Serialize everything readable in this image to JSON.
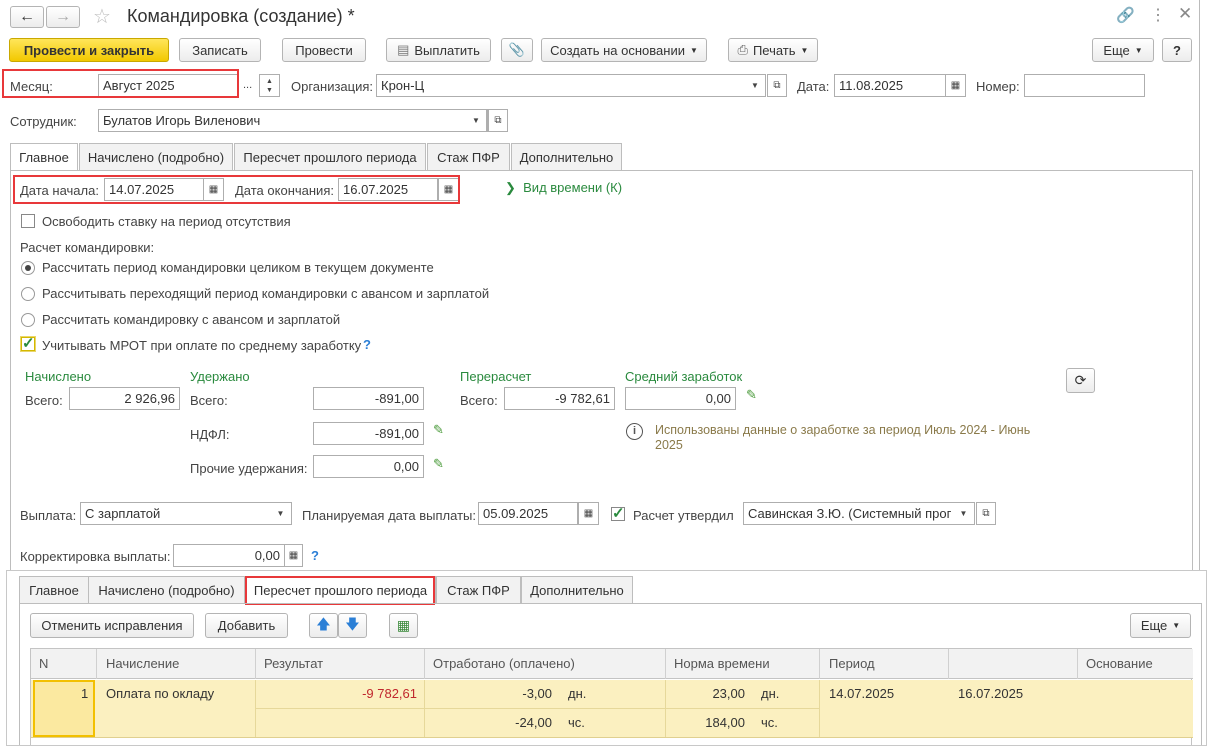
{
  "window": {
    "title": "Командировка (создание) *"
  },
  "toolbar": {
    "post_close": "Провести и закрыть",
    "save": "Записать",
    "post": "Провести",
    "pay": "Выплатить",
    "create_based": "Создать на основании",
    "print": "Печать",
    "more": "Еще",
    "help": "?"
  },
  "header": {
    "month_label": "Месяц:",
    "month_value": "Август 2025",
    "org_label": "Организация:",
    "org_value": "Крон-Ц",
    "date_label": "Дата:",
    "date_value": "11.08.2025",
    "number_label": "Номер:",
    "number_value": "",
    "employee_label": "Сотрудник:",
    "employee_value": "Булатов Игорь Виленович",
    "ellipsis": "..."
  },
  "tabs": [
    "Главное",
    "Начислено (подробно)",
    "Пересчет прошлого периода",
    "Стаж ПФР",
    "Дополнительно"
  ],
  "main": {
    "start_label": "Дата начала:",
    "start_value": "14.07.2025",
    "end_label": "Дата окончания:",
    "end_value": "16.07.2025",
    "time_type_link": "Вид времени (К)",
    "free_rate": "Освободить ставку на период отсутствия",
    "calc_label": "Расчет командировки:",
    "radio1": "Рассчитать период командировки целиком в текущем документе",
    "radio2": "Рассчитывать переходящий период командировки с авансом и зарплатой",
    "radio3": "Рассчитать командировку с авансом и зарплатой",
    "mrot": "Учитывать МРОТ при оплате по среднему заработку",
    "q": "?"
  },
  "totals": {
    "accrued_title": "Начислено",
    "accrued_total_label": "Всего:",
    "accrued_total": "2 926,96",
    "withheld_title": "Удержано",
    "withheld_total_label": "Всего:",
    "withheld_total": "-891,00",
    "ndfl_label": "НДФЛ:",
    "ndfl": "-891,00",
    "other_label": "Прочие удержания:",
    "other": "0,00",
    "recalc_title": "Перерасчет",
    "recalc_total_label": "Всего:",
    "recalc_total": "-9 782,61",
    "avg_title": "Средний заработок",
    "avg_value": "0,00",
    "info_text": "Использованы данные о заработке за период Июль 2024 - Июнь 2025"
  },
  "payment": {
    "pay_label": "Выплата:",
    "pay_value": "С зарплатой",
    "planned_label": "Планируемая дата выплаты:",
    "planned_value": "05.09.2025",
    "approved_label": "Расчет утвердил",
    "approved_value": "Савинская З.Ю. (Системный прог",
    "adjust_label": "Корректировка выплаты:",
    "adjust_value": "0,00"
  },
  "panel": {
    "cancel_fix": "Отменить исправления",
    "add": "Добавить",
    "more": "Еще",
    "columns": [
      "N",
      "Начисление",
      "Результат",
      "Отработано (оплачено)",
      "Норма времени",
      "Период",
      "",
      "Основание"
    ],
    "row": {
      "n": "1",
      "accrual": "Оплата по окладу",
      "result": "-9 782,61",
      "worked_days": "-3,00",
      "days_unit": "дн.",
      "worked_hours": "-24,00",
      "hours_unit": "чс.",
      "norm_days": "23,00",
      "norm_days_unit": "дн.",
      "norm_hours": "184,00",
      "norm_hours_unit": "чс.",
      "period_start": "14.07.2025",
      "period_end": "16.07.2025",
      "basis": ""
    }
  },
  "colors": {
    "accent_yellow": "#f2c800",
    "link_green": "#2a8a3e",
    "highlight_red": "#e8383a",
    "row_yellow": "#fbf0c0"
  }
}
